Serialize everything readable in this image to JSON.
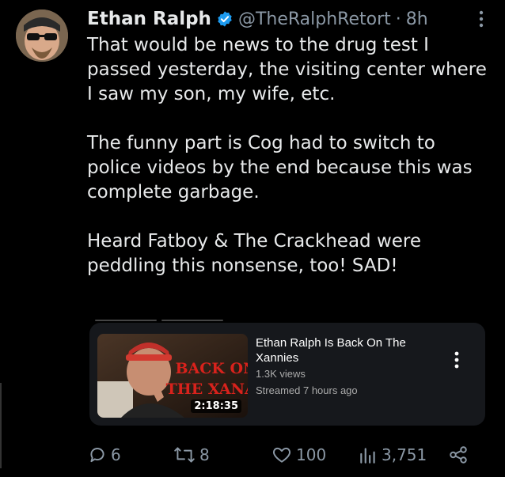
{
  "tweet": {
    "author_name": "Ethan Ralph",
    "handle": "@TheRalphRetort",
    "separator": "·",
    "time": "8h",
    "text": "That would be news to the drug test I passed yesterday, the visiting center where I saw my son, my wife, etc.\n\nThe funny part is Cog had to switch to police videos by the end because this was complete garbage.\n\nHeard Fatboy & The Crackhead were peddling this nonsense, too! SAD!"
  },
  "video_card": {
    "title": "Ethan Ralph Is Back On The Xannies",
    "views": "1.3K views",
    "streamed": "Streamed 7 hours ago",
    "duration": "2:18:35",
    "thumb_text_line1": "BACK ON",
    "thumb_text_line2": "THE XANAY"
  },
  "actions": {
    "replies": "6",
    "reposts": "8",
    "likes": "100",
    "views": "3,751"
  },
  "colors": {
    "background": "#000000",
    "text": "#e7e9ea",
    "muted": "#8b98a5",
    "verified": "#1d9bf0",
    "card_bg": "#16181c",
    "thumb_text": "#d8221c"
  },
  "icons": {
    "verified": "verified-badge-icon",
    "more": "more-vertical-icon",
    "reply": "reply-icon",
    "repost": "repost-icon",
    "like": "heart-icon",
    "views": "views-chart-icon",
    "share": "share-icon"
  }
}
